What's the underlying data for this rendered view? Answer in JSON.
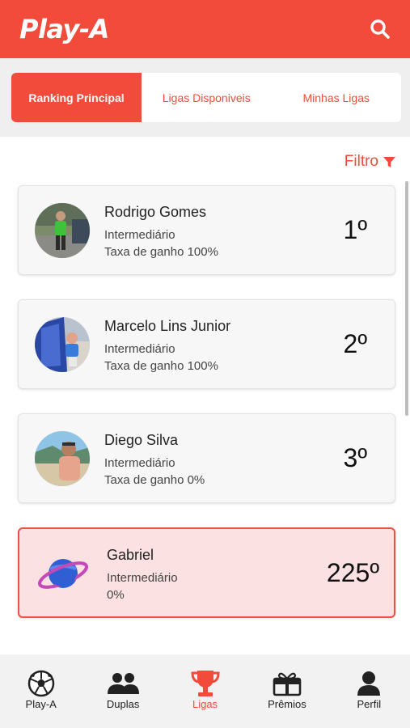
{
  "app": {
    "logo": "Play-A"
  },
  "tabs": [
    {
      "label": "Ranking Principal",
      "active": true
    },
    {
      "label": "Ligas Disponiveis",
      "active": false
    },
    {
      "label": "Minhas Ligas",
      "active": false
    }
  ],
  "filter": {
    "label": "Filtro"
  },
  "ranking": [
    {
      "name": "Rodrigo Gomes",
      "level": "Intermediário",
      "rate": "Taxa de ganho 100%",
      "position": "1º"
    },
    {
      "name": "Marcelo Lins Junior",
      "level": "Intermediário",
      "rate": "Taxa de ganho 100%",
      "position": "2º"
    },
    {
      "name": "Diego Silva",
      "level": "Intermediário",
      "rate": "Taxa de ganho 0%",
      "position": "3º"
    }
  ],
  "current_user": {
    "name": "Gabriel",
    "level": "Intermediário",
    "rate": "0%",
    "position": "225º"
  },
  "nav": [
    {
      "label": "Play-A",
      "icon": "soccer-ball-icon"
    },
    {
      "label": "Duplas",
      "icon": "users-icon"
    },
    {
      "label": "Ligas",
      "icon": "trophy-icon",
      "active": true
    },
    {
      "label": "Prêmios",
      "icon": "gift-icon"
    },
    {
      "label": "Perfil",
      "icon": "user-icon"
    }
  ],
  "colors": {
    "brand": "#f24b3b",
    "highlight_bg": "#fbe1e1"
  }
}
